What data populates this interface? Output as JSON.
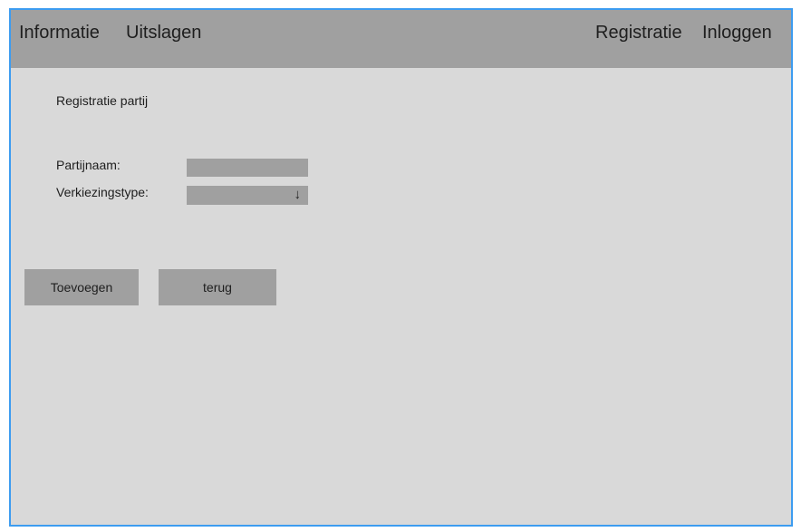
{
  "nav": {
    "left": [
      "Informatie",
      "Uitslagen"
    ],
    "right": [
      "Registratie",
      "Inloggen"
    ]
  },
  "page": {
    "title": "Registratie partij"
  },
  "form": {
    "partijnaam_label": "Partijnaam:",
    "partijnaam_value": "",
    "verkiezingstype_label": "Verkiezingstype:",
    "verkiezingstype_value": "",
    "dropdown_icon": "arrow-down-icon"
  },
  "buttons": {
    "add_label": "Toevoegen",
    "back_label": "terug"
  },
  "colors": {
    "frame_border": "#3d9cf0",
    "background": "#d9d9d9",
    "bar": "#a0a0a0",
    "text": "#1e1e1e"
  }
}
